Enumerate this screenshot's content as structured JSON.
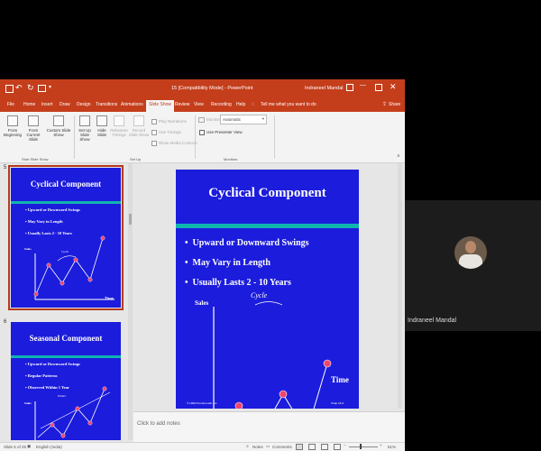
{
  "window": {
    "title": "15 [Compatibility Mode] - PowerPoint",
    "user": "Indraneel Mandal",
    "share_label": "Share"
  },
  "tabs": [
    "File",
    "Home",
    "Insert",
    "Draw",
    "Design",
    "Transitions",
    "Animations",
    "Slide Show",
    "Review",
    "View",
    "Recording",
    "Help"
  ],
  "active_tab": "Slide Show",
  "tell_me": "Tell me what you want to do",
  "ribbon": {
    "from_beginning": "From Beginning",
    "from_current": "From Current Slide",
    "custom_show": "Custom Slide Show",
    "group_start": "Start Slide Show",
    "setup_show": "Set Up Slide Show",
    "hide_slide": "Hide Slide",
    "rehearse": "Rehearse Timings",
    "record": "Record Slide Show",
    "play_narrations": "Play Narrations",
    "use_timings": "Use Timings",
    "show_media": "Show Media Controls",
    "group_setup": "Set Up",
    "monitor_label": "Monitor:",
    "monitor_value": "Automatic",
    "presenter_view": "Use Presenter View",
    "group_monitors": "Monitors"
  },
  "slides": [
    {
      "number": "5",
      "title": "Cyclical Component",
      "bullets": [
        "Upward or Downward Swings",
        "May Vary in Length",
        "Usually Lasts 2 - 10 Years"
      ],
      "y_label": "Sales",
      "x_label": "Time",
      "curve_label": "Cycle",
      "copyright": "© 1999 Prentice-Hall, Inc.",
      "footer_num": "Chap 16-6"
    },
    {
      "number": "6",
      "title": "Seasonal Component",
      "bullets": [
        "Upward or Downward Swings",
        "Regular Patterns",
        "Observed Within 1 Year"
      ],
      "y_label": "Sales",
      "curve_label": "Winter"
    }
  ],
  "notes_placeholder": "Click to add notes",
  "status": {
    "slide_counter": "Slide 5 of 25",
    "language": "English (India)",
    "notes": "Notes",
    "comments": "Comments",
    "zoom": "61%"
  },
  "presenter": {
    "name": "Indraneel Mandal"
  },
  "colors": {
    "brand": "#c43e1c",
    "slide_bg": "#1c1cdc",
    "teal_band": "#10b5b0",
    "point": "#f0446d",
    "curve": "#f0446d"
  }
}
